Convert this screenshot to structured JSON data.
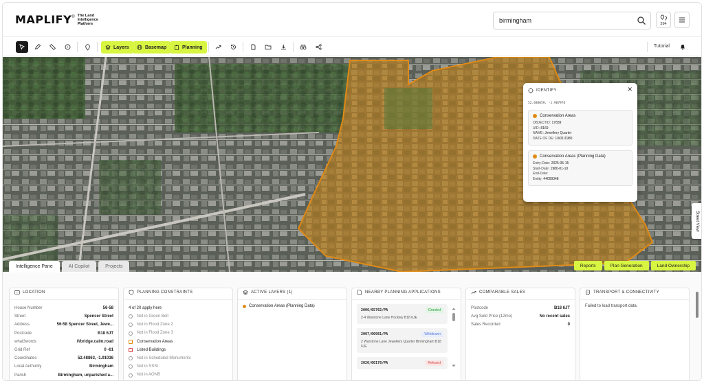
{
  "brand": {
    "name": "MAPLIFY",
    "trademark": "®",
    "tagline": "The Land Intelligence Platform"
  },
  "search": {
    "value": "birmingham"
  },
  "header": {
    "notification_count": "394"
  },
  "toolbar": {
    "layers": "Layers",
    "basemap": "Basemap",
    "planning": "Planning",
    "tutorial": "Tutorial"
  },
  "identify": {
    "title": "IDENTIFY",
    "coords": "52.488059, -1.907976",
    "cards": [
      {
        "title": "Conservation Areas",
        "rows": [
          {
            "k": "OBJECTID:",
            "v": "17839"
          },
          {
            "k": "UID:",
            "v": "8169"
          },
          {
            "k": "NAME:",
            "v": "Jewellery Quarter"
          },
          {
            "k": "DATE OF DE:",
            "v": "10/01/1980"
          }
        ]
      },
      {
        "title": "Conservation Areas (Planning Data)",
        "rows": [
          {
            "k": "Entry-Date:",
            "v": "2025-05-15"
          },
          {
            "k": "Start-Date:",
            "v": "1980-01-10"
          },
          {
            "k": "End-Date:",
            "v": ""
          },
          {
            "k": "Entity:",
            "v": "44009348"
          }
        ]
      }
    ]
  },
  "map_tabs": [
    "Intelligence Pane",
    "AI Copilot",
    "Projects"
  ],
  "map_actions": [
    "Reports",
    "Plan Generation",
    "Land Ownership"
  ],
  "street_view": "Street View",
  "location": {
    "title": "LOCATION",
    "rows": [
      {
        "k": "House Number",
        "v": "56-58"
      },
      {
        "k": "Street",
        "v": "Spencer Street"
      },
      {
        "k": "Address",
        "v": "56-58 Spencer Street, Jewe..."
      },
      {
        "k": "Postcode",
        "v": "B18 6JT"
      },
      {
        "k": "what3words",
        "v": "///bridge.calm.road"
      },
      {
        "k": "Grid Ref",
        "v": "0 -61"
      },
      {
        "k": "Coordinates",
        "v": "52.48863, -1.91036"
      },
      {
        "k": "Local Authority",
        "v": "Birmingham"
      },
      {
        "k": "Parish",
        "v": "Birmingham, unparished a..."
      }
    ]
  },
  "constraints": {
    "title": "PLANNING CONSTRAINTS",
    "summary": "4 of 20 apply here",
    "items": [
      {
        "label": "Not in Green Belt",
        "hit": false,
        "icon": "tree-icon"
      },
      {
        "label": "Not in Flood Zone 2",
        "hit": false,
        "icon": "waves-icon"
      },
      {
        "label": "Not in Flood Zone 3",
        "hit": false,
        "icon": "waves-icon"
      },
      {
        "label": "Conservation Areas",
        "hit": true,
        "icon": "landmark-icon"
      },
      {
        "label": "Listed Buildings",
        "hit": true,
        "icon": "shield-icon"
      },
      {
        "label": "Not in Scheduled Monuments",
        "hit": false,
        "icon": "monument-icon"
      },
      {
        "label": "Not in SSSI",
        "hit": false,
        "icon": "leaf-icon"
      },
      {
        "label": "Not in AONB",
        "hit": false,
        "icon": "mountain-icon"
      }
    ]
  },
  "active_layers": {
    "title": "ACTIVE LAYERS (1)",
    "items": [
      "Conservation Areas (Planning Data)"
    ]
  },
  "applications": {
    "title": "NEARBY PLANNING APPLICATIONS",
    "items": [
      {
        "ref": "2006/05762/PA",
        "status": "Granted",
        "addr": "2-4 Warstone Lane Hockley B18 6JE",
        "color": "#2e9e44",
        "bg": "#e2f5e4"
      },
      {
        "ref": "2007/00981/PA",
        "status": "Withdrawn",
        "addr": "2 Warstone Lane Jewellery Quarter Birmingham B18 6JE",
        "color": "#5a7ed6",
        "bg": "#e7edfb"
      },
      {
        "ref": "2020/00178/PA",
        "status": "Refused",
        "addr": "",
        "color": "#d64545",
        "bg": "#fbe6e6"
      }
    ]
  },
  "sales": {
    "title": "COMPARABLE SALES",
    "rows": [
      {
        "k": "Postcode",
        "v": "B18 6JT"
      },
      {
        "k": "Avg Sold Price (12mo)",
        "v": "No recent sales"
      },
      {
        "k": "Sales Recorded",
        "v": "0"
      }
    ]
  },
  "transport": {
    "title": "TRANSPORT & CONNECTIVITY",
    "message": "Failed to load transport data."
  },
  "colors": {
    "accent": "#d8f542",
    "conservation": "#e08a15"
  }
}
